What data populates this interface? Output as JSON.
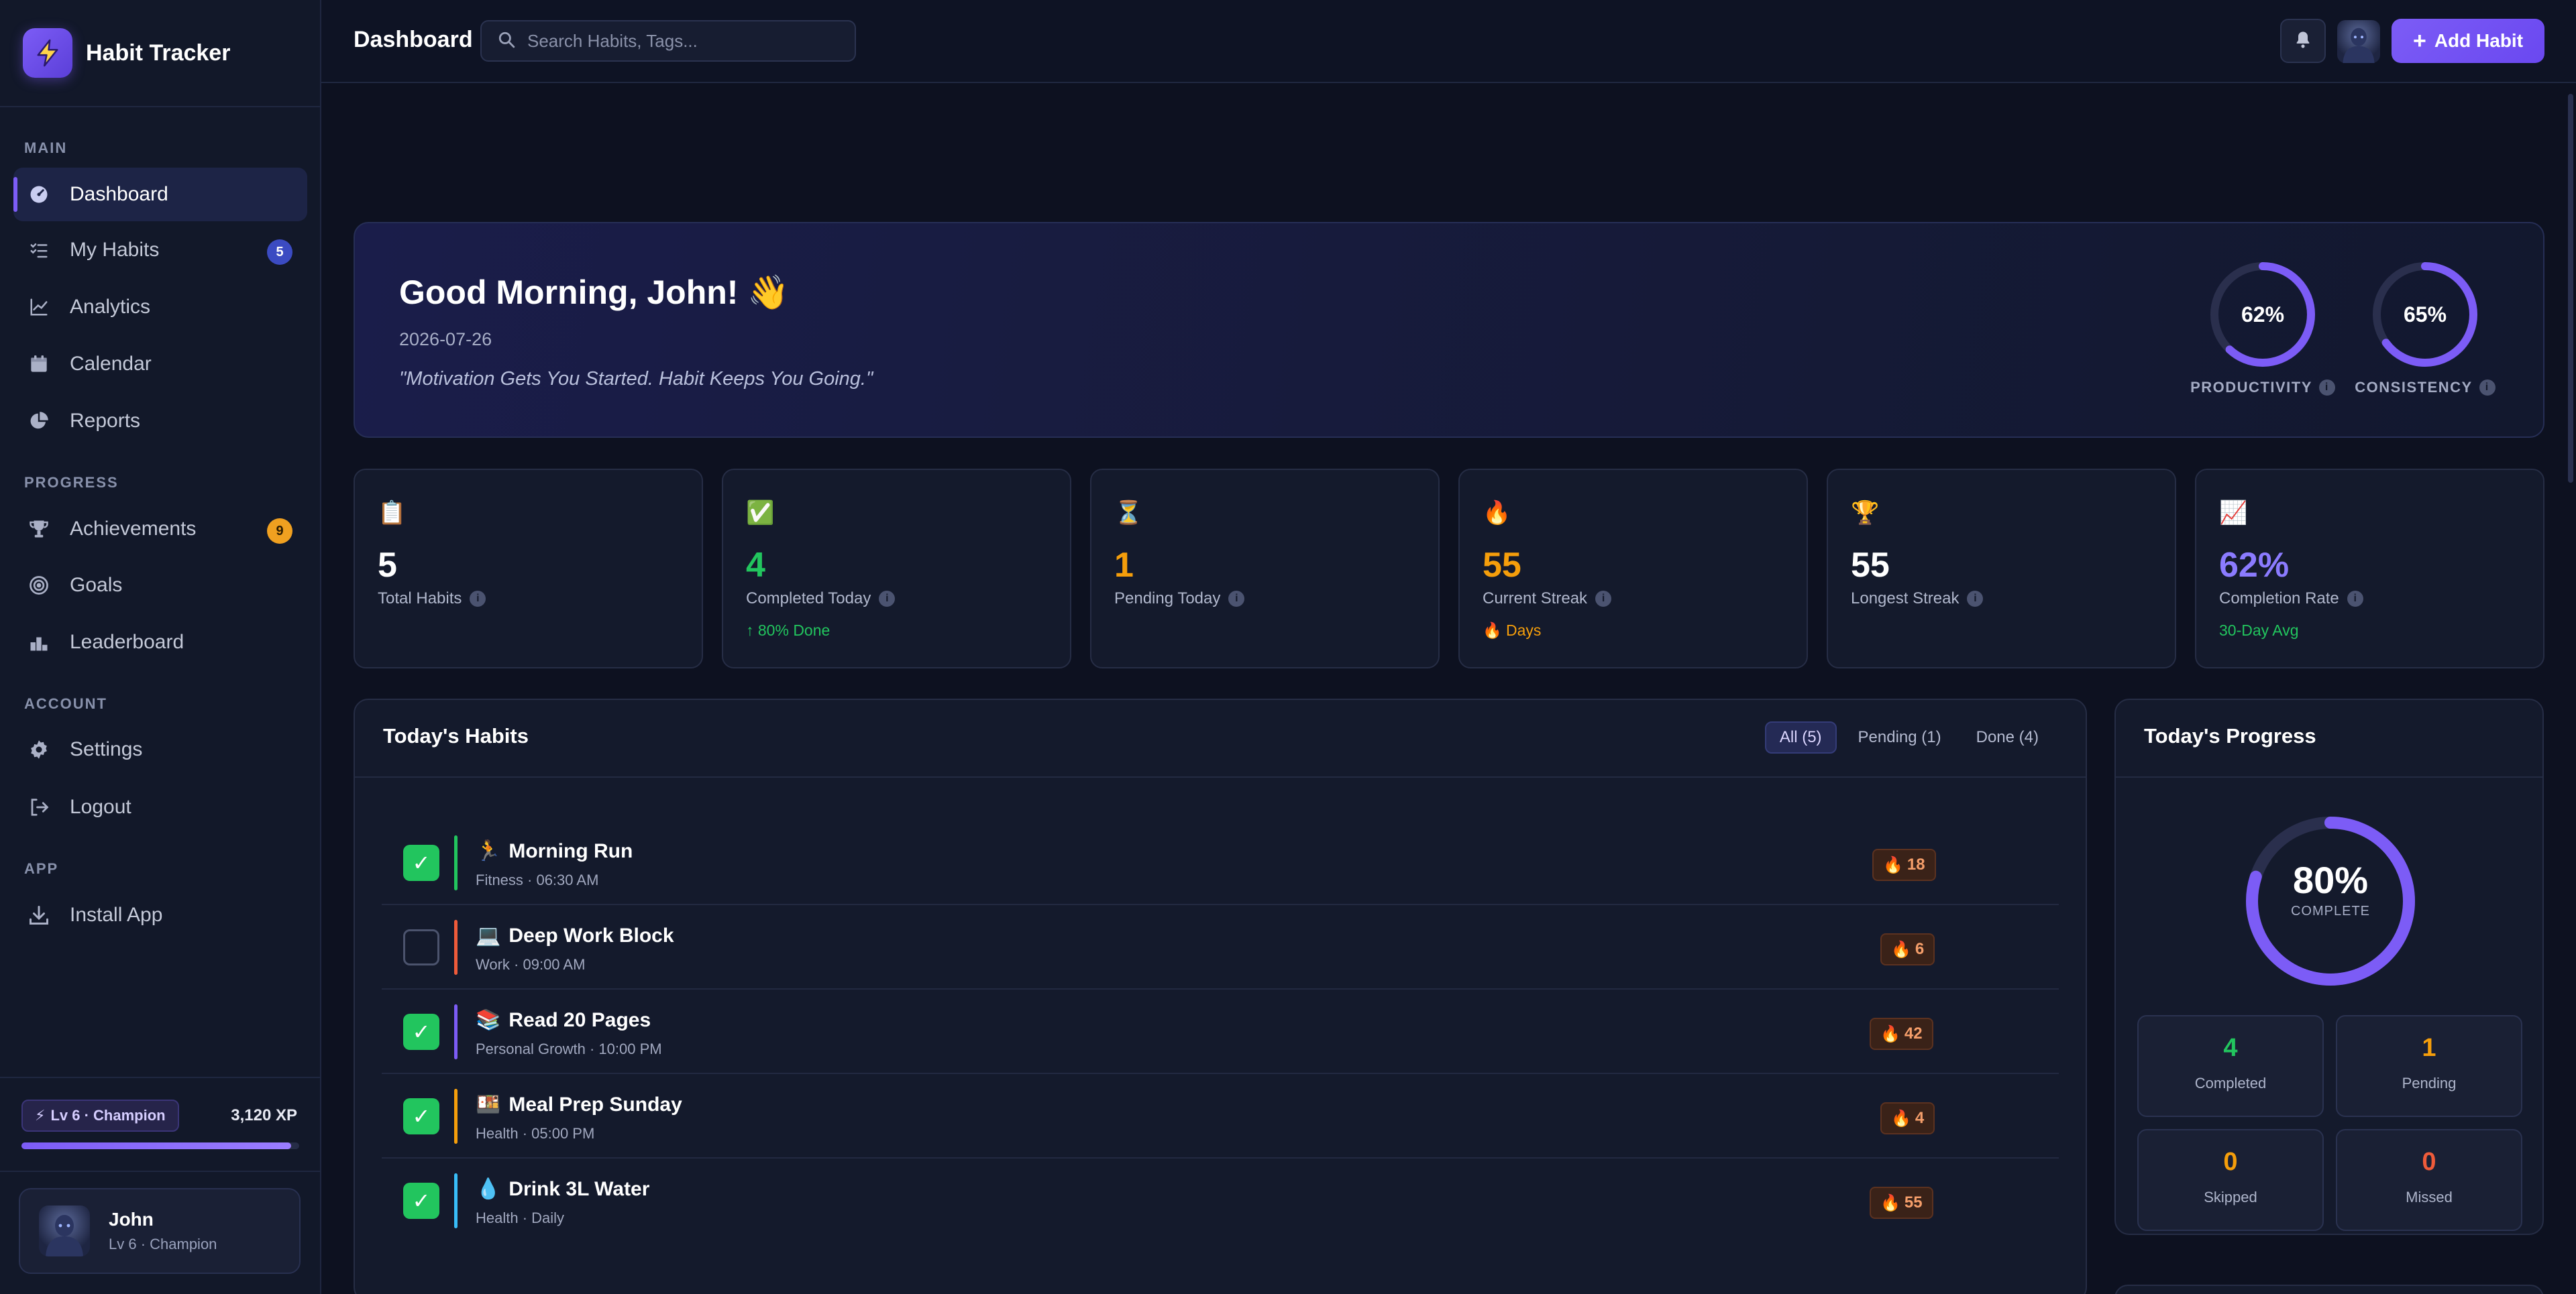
{
  "app": {
    "name": "Habit Tracker"
  },
  "sidebar": {
    "sections": {
      "main": "MAIN",
      "progress": "PROGRESS",
      "account": "ACCOUNT",
      "app": "APP"
    },
    "items": {
      "dashboard": {
        "label": "Dashboard"
      },
      "my_habits": {
        "label": "My Habits",
        "badge": "5"
      },
      "analytics": {
        "label": "Analytics"
      },
      "calendar": {
        "label": "Calendar"
      },
      "reports": {
        "label": "Reports"
      },
      "achievements": {
        "label": "Achievements",
        "badge": "9"
      },
      "goals": {
        "label": "Goals"
      },
      "leaderboard": {
        "label": "Leaderboard"
      },
      "settings": {
        "label": "Settings"
      },
      "logout": {
        "label": "Logout"
      },
      "install": {
        "label": "Install App"
      }
    },
    "level": {
      "label": "Lv 6 · Champion",
      "xp": "3,120 XP",
      "progress_fraction": 0.97
    },
    "user": {
      "name": "John",
      "subtitle": "Lv 6 · Champion"
    }
  },
  "header": {
    "title": "Dashboard",
    "search_placeholder": "Search Habits, Tags...",
    "add_button": "Add Habit"
  },
  "hero": {
    "greeting": "Good Morning, John! 👋",
    "date": "2026-07-26",
    "quote": "\"Motivation Gets You Started. Habit Keeps You Going.\"",
    "rings": [
      {
        "label": "PRODUCTIVITY",
        "value": "62%",
        "fraction": 0.62
      },
      {
        "label": "CONSISTENCY",
        "value": "65%",
        "fraction": 0.65
      }
    ]
  },
  "stats": [
    {
      "icon": "📋",
      "value": "5",
      "label": "Total Habits",
      "sub": "",
      "color": "#ffffff"
    },
    {
      "icon": "✅",
      "value": "4",
      "label": "Completed Today",
      "sub": "↑ 80% Done",
      "color": "#22c55e",
      "sub_color": "#22c55e"
    },
    {
      "icon": "⏳",
      "value": "1",
      "label": "Pending Today",
      "sub": "",
      "color": "#f59e0b"
    },
    {
      "icon": "🔥",
      "value": "55",
      "label": "Current Streak",
      "sub": "🔥 Days",
      "color": "#f59e0b",
      "sub_color": "#f59e0b"
    },
    {
      "icon": "🏆",
      "value": "55",
      "label": "Longest Streak",
      "sub": "",
      "color": "#ffffff"
    },
    {
      "icon": "📈",
      "value": "62%",
      "label": "Completion Rate",
      "sub": "30-Day Avg",
      "color": "#8b7bff",
      "sub_color": "#22c55e"
    }
  ],
  "habits_panel": {
    "title": "Today's Habits",
    "filters": [
      {
        "label": "All (5)",
        "active": true
      },
      {
        "label": "Pending (1)",
        "active": false
      },
      {
        "label": "Done (4)",
        "active": false
      }
    ],
    "habits": [
      {
        "emoji": "🏃",
        "name": "Morning Run",
        "meta": "Fitness · 06:30 AM",
        "done": true,
        "color": "#22c55e",
        "streak": "18"
      },
      {
        "emoji": "💻",
        "name": "Deep Work Block",
        "meta": "Work · 09:00 AM",
        "done": false,
        "color": "#ef5b3a",
        "streak": "6"
      },
      {
        "emoji": "📚",
        "name": "Read 20 Pages",
        "meta": "Personal Growth · 10:00 PM",
        "done": true,
        "color": "#7c5cf6",
        "streak": "42"
      },
      {
        "emoji": "🍱",
        "name": "Meal Prep Sunday",
        "meta": "Health · 05:00 PM",
        "done": true,
        "color": "#f59e0b",
        "streak": "4"
      },
      {
        "emoji": "💧",
        "name": "Drink 3L Water",
        "meta": "Health · Daily",
        "done": true,
        "color": "#38bdf8",
        "streak": "55"
      }
    ]
  },
  "progress_panel": {
    "title": "Today's Progress",
    "percent": "80%",
    "fraction": 0.8,
    "percent_label": "COMPLETE",
    "tiles": [
      {
        "value": "4",
        "label": "Completed",
        "color": "#22c55e"
      },
      {
        "value": "1",
        "label": "Pending",
        "color": "#f59e0b"
      },
      {
        "value": "0",
        "label": "Skipped",
        "color": "#f59e0b"
      },
      {
        "value": "0",
        "label": "Missed",
        "color": "#ef5b3a"
      }
    ]
  },
  "colors": {
    "accent": "#7c5cf6",
    "success": "#22c55e",
    "warning": "#f59e0b",
    "danger": "#ef5b3a"
  }
}
